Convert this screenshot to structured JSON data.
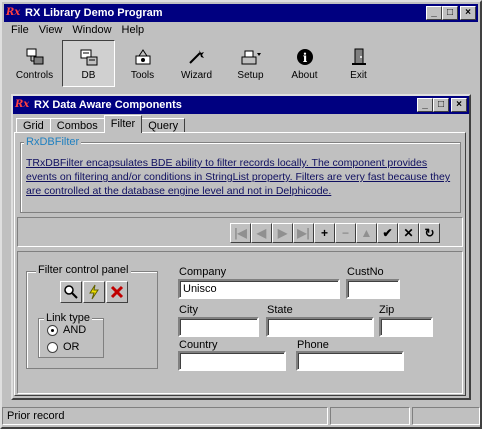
{
  "app": {
    "title": "RX Library Demo Program",
    "logo_text": "Rx"
  },
  "menu": [
    "File",
    "View",
    "Window",
    "Help"
  ],
  "toolbar": [
    {
      "label": "Controls",
      "icon": "controls-icon"
    },
    {
      "label": "DB",
      "icon": "database-icon",
      "active": true
    },
    {
      "label": "Tools",
      "icon": "tools-icon"
    },
    {
      "label": "Wizard",
      "icon": "wizard-icon"
    },
    {
      "label": "Setup",
      "icon": "setup-icon"
    },
    {
      "label": "About",
      "icon": "info-icon"
    },
    {
      "label": "Exit",
      "icon": "exit-icon"
    }
  ],
  "child": {
    "title": "RX Data Aware Components",
    "tabs": [
      "Grid",
      "Combos",
      "Filter",
      "Query"
    ],
    "active_tab": "Filter"
  },
  "filter_group": {
    "legend": "RxDBFilter",
    "description": "TRxDBFilter encapsulates BDE ability to filter records locally. The component provides events on filtering and/or conditions in StringList property. Filters are very fast because they are controlled at the database engine level and not in Delphicode."
  },
  "navigator": [
    "first",
    "prior",
    "next",
    "last",
    "insert",
    "delete",
    "edit",
    "post",
    "cancel",
    "refresh"
  ],
  "control_panel": {
    "legend": "Filter control panel",
    "link_type_legend": "Link type",
    "options": [
      "AND",
      "OR"
    ],
    "selected": "AND"
  },
  "fields": {
    "company_label": "Company",
    "company_value": "Unisco",
    "custno_label": "CustNo",
    "custno_value": "",
    "city_label": "City",
    "city_value": "",
    "state_label": "State",
    "state_value": "",
    "zip_label": "Zip",
    "zip_value": "",
    "country_label": "Country",
    "country_value": "",
    "phone_label": "Phone",
    "phone_value": ""
  },
  "status": {
    "text": "Prior record"
  },
  "colors": {
    "title_bar": "#000080",
    "face": "#c0c0c0",
    "legend_blue": "#2080c0"
  }
}
